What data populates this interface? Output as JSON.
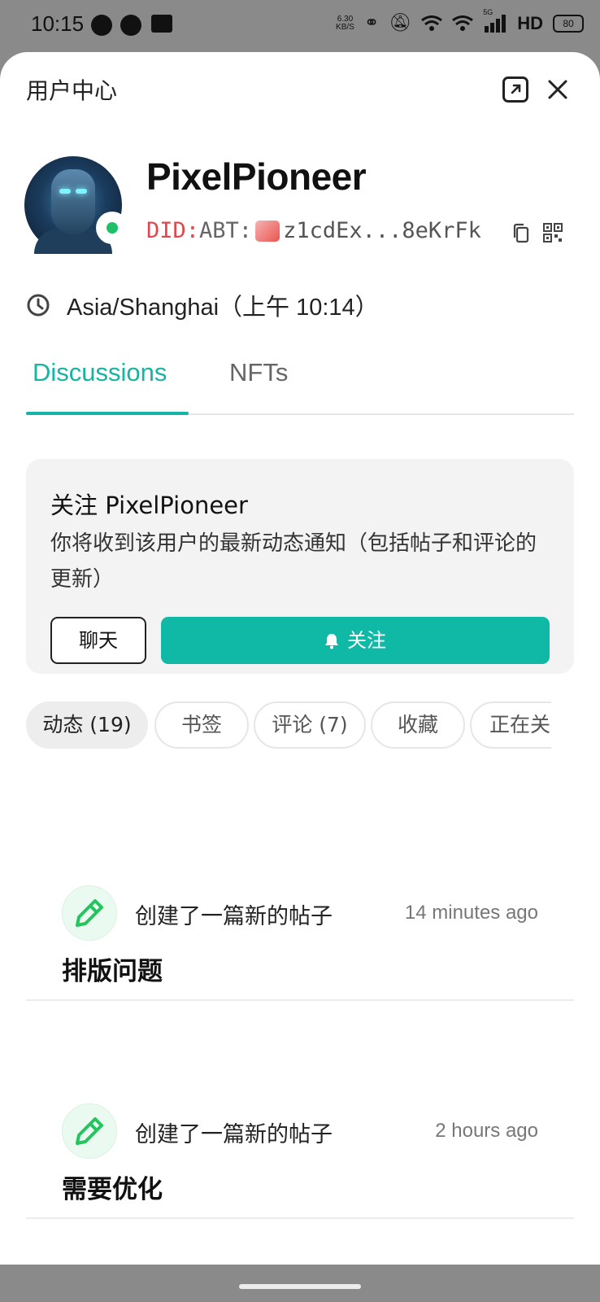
{
  "status_bar": {
    "time": "10:15",
    "speed_value": "6.30",
    "speed_unit": "KB/S",
    "network": "HD",
    "battery": "80",
    "sim_label": "5G",
    "icons": [
      "messenger-icon",
      "chat-icon",
      "gmail-icon",
      "hotspot-icon",
      "mute-icon",
      "wifi-icon",
      "wifi-icon",
      "signal-icon"
    ]
  },
  "header": {
    "title": "用户中心"
  },
  "profile": {
    "username": "PixelPioneer",
    "did_prefix": "DID:",
    "did_type": "ABT:",
    "did_value": "z1cdEx...8eKrFk",
    "online": true,
    "timezone": "Asia/Shanghai（上午 10:14）"
  },
  "tabs": [
    {
      "label": "Discussions",
      "active": true
    },
    {
      "label": "NFTs",
      "active": false
    }
  ],
  "follow_card": {
    "title": "关注 PixelPioneer",
    "description": "你将收到该用户的最新动态通知（包括帖子和评论的更新）",
    "chat_label": "聊天",
    "follow_label": "关注"
  },
  "filter_chips": [
    {
      "label": "动态 (19)",
      "active": true
    },
    {
      "label": "书签",
      "active": false
    },
    {
      "label": "评论 (7)",
      "active": false
    },
    {
      "label": "收藏",
      "active": false
    },
    {
      "label": "正在关",
      "active": false
    }
  ],
  "activities": [
    {
      "action": "创建了一篇新的帖子",
      "time": "14 minutes ago",
      "title": "排版问题"
    },
    {
      "action": "创建了一篇新的帖子",
      "time": "2 hours ago",
      "title": "需要优化"
    }
  ],
  "colors": {
    "accent": "#17b3a3",
    "follow_button": "#10b8a6",
    "did_prefix": "#e0474c",
    "online": "#1ec06a",
    "activity_icon": "#22c55e"
  }
}
